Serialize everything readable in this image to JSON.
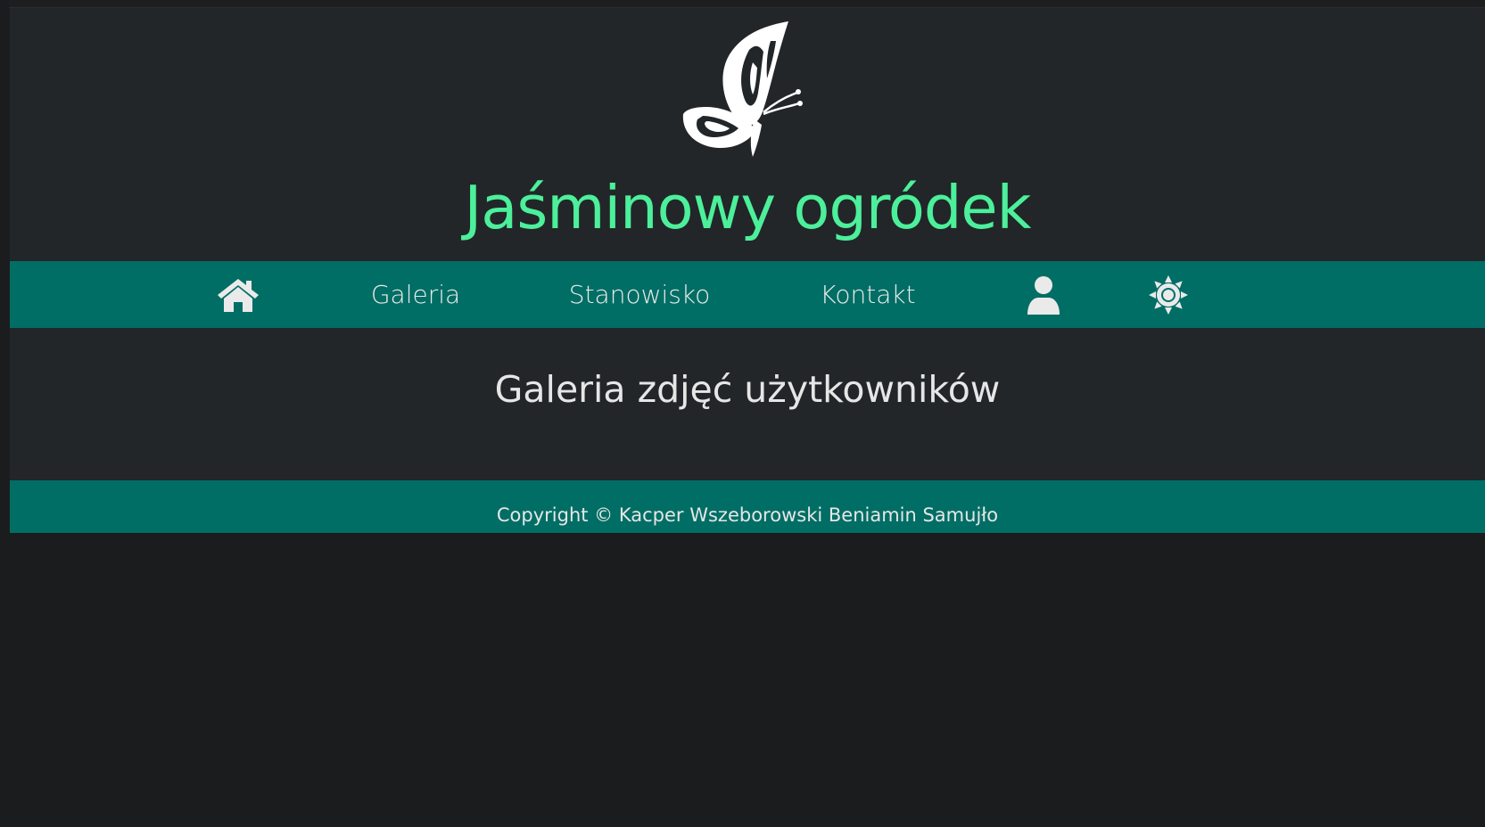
{
  "site": {
    "title": "Jaśminowy ogródek"
  },
  "nav": {
    "items": [
      {
        "name": "home",
        "icon": "home-icon"
      },
      {
        "name": "gallery",
        "label": "Galeria"
      },
      {
        "name": "station",
        "label": "Stanowisko"
      },
      {
        "name": "contact",
        "label": "Kontakt"
      },
      {
        "name": "user",
        "icon": "user-icon"
      },
      {
        "name": "theme",
        "icon": "sun-icon"
      }
    ]
  },
  "main": {
    "heading": "Galeria zdjęć użytkowników"
  },
  "footer": {
    "copyright": "Copyright © Kacper Wszeborowski Beniamin Samujło"
  },
  "colors": {
    "accent": "#4cf09a",
    "nav_bg": "#006e65",
    "header_bg": "#222629",
    "page_bg": "#1b1c1e"
  },
  "icons": {
    "logo": "butterfly-icon"
  }
}
